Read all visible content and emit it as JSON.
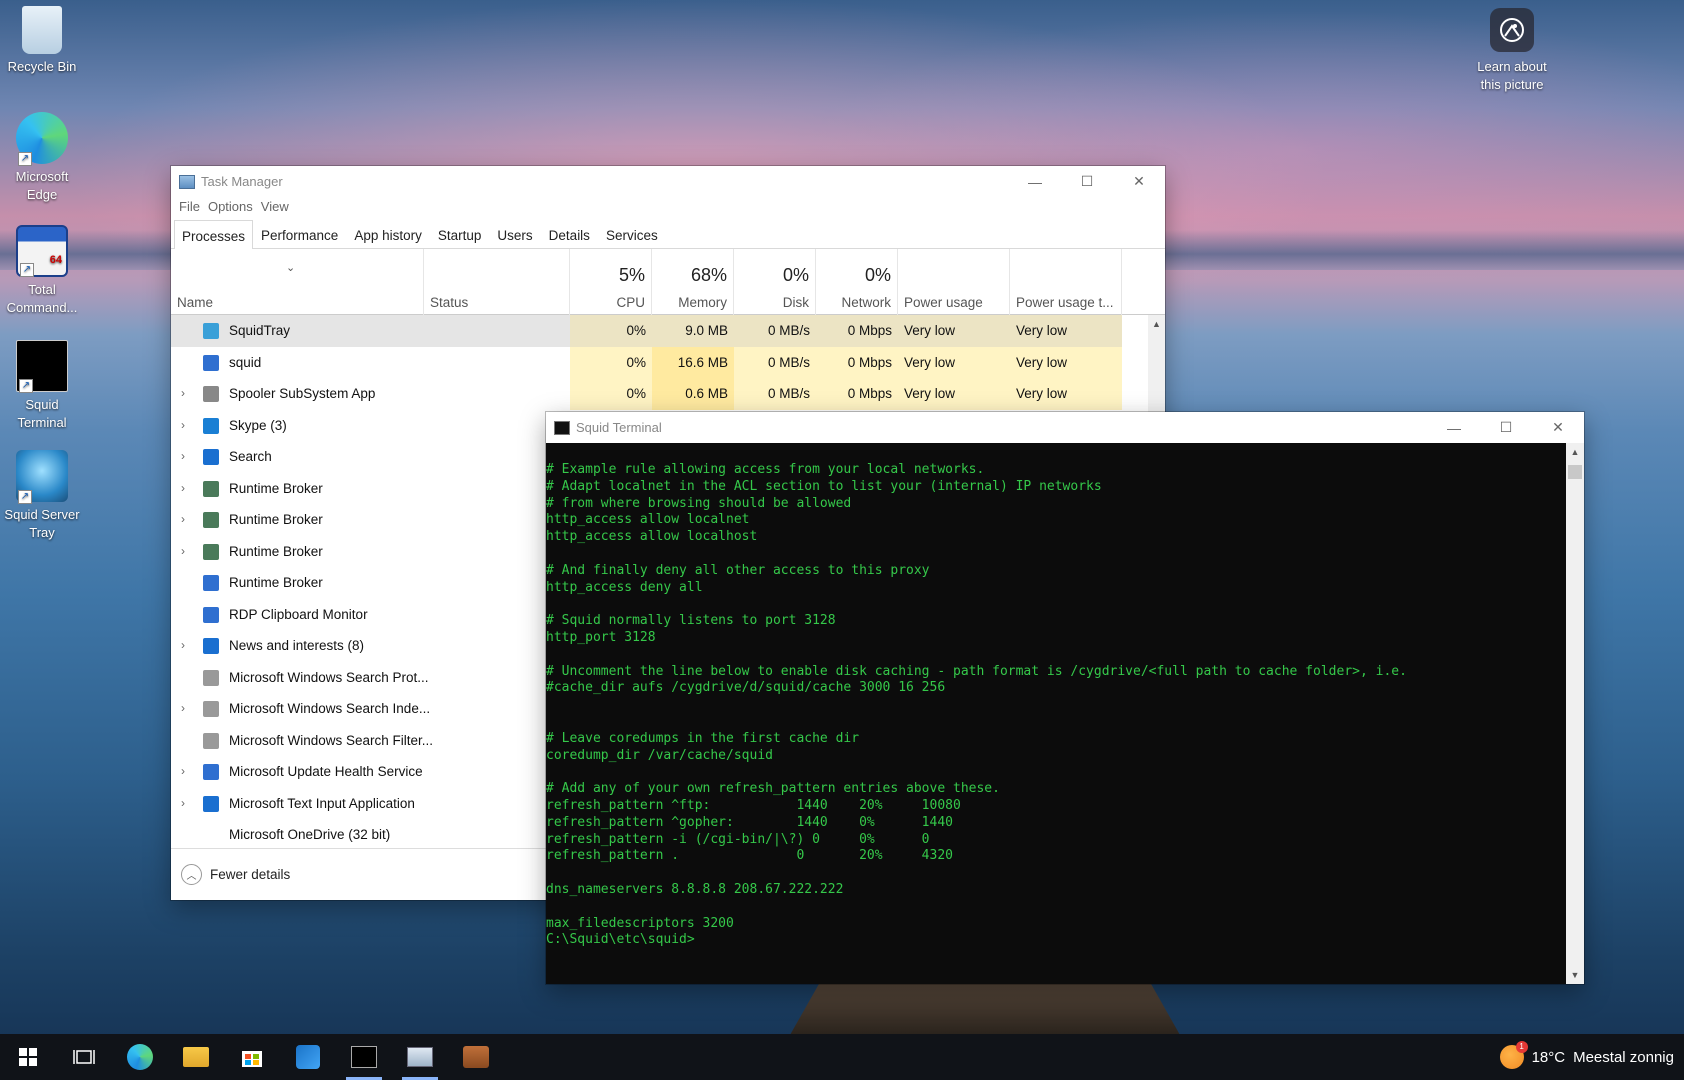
{
  "desktop": {
    "icons": [
      {
        "label": "Recycle Bin"
      },
      {
        "label": "Microsoft Edge"
      },
      {
        "label": "Total Command..."
      },
      {
        "label": "Squid Terminal"
      },
      {
        "label": "Squid Server Tray"
      }
    ],
    "learn_about": "Learn about this picture"
  },
  "taskmgr": {
    "title": "Task Manager",
    "menu": [
      "File",
      "Options",
      "View"
    ],
    "tabs": [
      "Processes",
      "Performance",
      "App history",
      "Startup",
      "Users",
      "Details",
      "Services"
    ],
    "columns": {
      "name": "Name",
      "status": "Status",
      "cpu": {
        "pct": "5%",
        "label": "CPU"
      },
      "memory": {
        "pct": "68%",
        "label": "Memory"
      },
      "disk": {
        "pct": "0%",
        "label": "Disk"
      },
      "network": {
        "pct": "0%",
        "label": "Network"
      },
      "power": "Power usage",
      "power_trend": "Power usage t..."
    },
    "rows": [
      {
        "name": "SquidTray",
        "cpu": "0%",
        "mem": "9.0 MB",
        "disk": "0 MB/s",
        "net": "0 Mbps",
        "pw": "Very low",
        "pwt": "Very low"
      },
      {
        "name": "squid",
        "cpu": "0%",
        "mem": "16.6 MB",
        "disk": "0 MB/s",
        "net": "0 Mbps",
        "pw": "Very low",
        "pwt": "Very low"
      },
      {
        "name": "Spooler SubSystem App",
        "cpu": "0%",
        "mem": "0.6 MB",
        "disk": "0 MB/s",
        "net": "0 Mbps",
        "pw": "Very low",
        "pwt": "Very low"
      },
      {
        "name": "Skype (3)"
      },
      {
        "name": "Search"
      },
      {
        "name": "Runtime Broker"
      },
      {
        "name": "Runtime Broker"
      },
      {
        "name": "Runtime Broker"
      },
      {
        "name": "Runtime Broker"
      },
      {
        "name": "RDP Clipboard Monitor"
      },
      {
        "name": "News and interests (8)"
      },
      {
        "name": "Microsoft Windows Search Prot..."
      },
      {
        "name": "Microsoft Windows Search Inde..."
      },
      {
        "name": "Microsoft Windows Search Filter..."
      },
      {
        "name": "Microsoft Update Health Service"
      },
      {
        "name": "Microsoft Text Input Application"
      },
      {
        "name": "Microsoft OneDrive (32 bit)"
      }
    ],
    "footer": "Fewer details"
  },
  "terminal": {
    "title": "Squid Terminal",
    "lines": [
      "# Example rule allowing access from your local networks.",
      "# Adapt localnet in the ACL section to list your (internal) IP networks",
      "# from where browsing should be allowed",
      "http_access allow localnet",
      "http_access allow localhost",
      "",
      "# And finally deny all other access to this proxy",
      "http_access deny all",
      "",
      "# Squid normally listens to port 3128",
      "http_port 3128",
      "",
      "# Uncomment the line below to enable disk caching - path format is /cygdrive/<full path to cache folder>, i.e.",
      "#cache_dir aufs /cygdrive/d/squid/cache 3000 16 256",
      "",
      "",
      "# Leave coredumps in the first cache dir",
      "coredump_dir /var/cache/squid",
      "",
      "# Add any of your own refresh_pattern entries above these.",
      "refresh_pattern ^ftp:           1440    20%     10080",
      "refresh_pattern ^gopher:        1440    0%      1440",
      "refresh_pattern -i (/cgi-bin/|\\?) 0     0%      0",
      "refresh_pattern .               0       20%     4320",
      "",
      "dns_nameservers 8.8.8.8 208.67.222.222",
      "",
      "max_filedescriptors 3200",
      "C:\\Squid\\etc\\squid>"
    ]
  },
  "taskbar": {
    "weather_temp": "18°C",
    "weather_text": "Meestal zonnig",
    "badge": "1"
  }
}
